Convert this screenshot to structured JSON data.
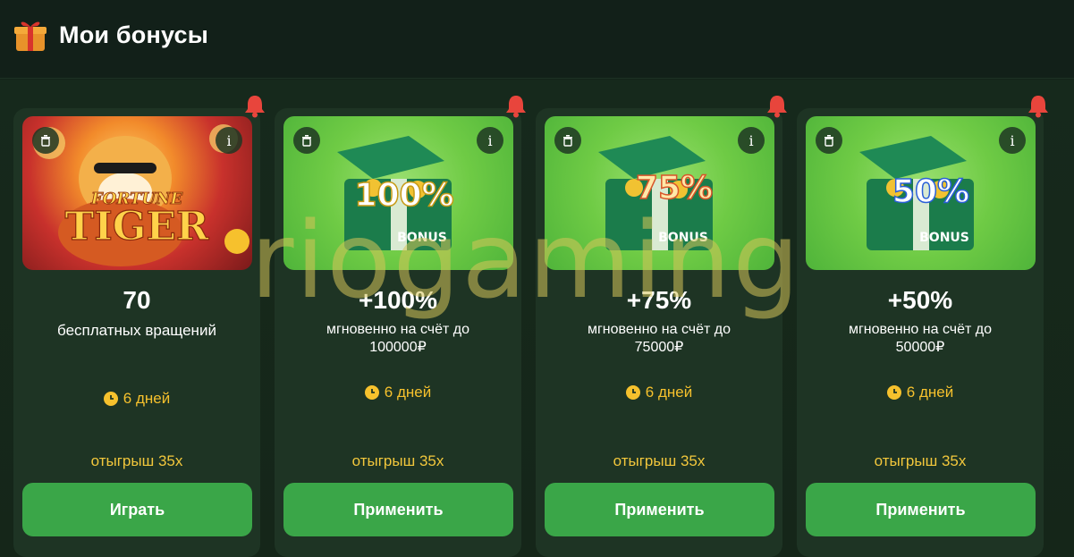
{
  "header": {
    "title": "Мои бонусы",
    "icon": "gift-icon"
  },
  "colors": {
    "accent_green": "#3aa648",
    "timer_yellow": "#f6c12d",
    "bell_red": "#e8453c"
  },
  "cards": [
    {
      "image": "fortune-tiger",
      "image_text": "FORTUNE TIGER",
      "value": "70",
      "description": "бесплатных вращений",
      "timer": "6 дней",
      "wager": "отыгрыш 35x",
      "button": "Играть"
    },
    {
      "image": "bonus-chest",
      "image_text": "100%",
      "image_label": "BONUS",
      "value": "+100%",
      "description": "мгновенно на счёт до 100000₽",
      "timer": "6 дней",
      "wager": "отыгрыш 35x",
      "button": "Применить"
    },
    {
      "image": "bonus-chest",
      "image_text": "75%",
      "image_label": "BONUS",
      "value": "+75%",
      "description": "мгновенно на счёт до 75000₽",
      "timer": "6 дней",
      "wager": "отыгрыш 35x",
      "button": "Применить"
    },
    {
      "image": "bonus-chest",
      "image_text": "50%",
      "image_label": "BONUS",
      "value": "+50%",
      "description": "мгновенно на счёт до 50000₽",
      "timer": "6 дней",
      "wager": "отыгрыш 35x",
      "button": "Применить"
    }
  ],
  "watermark": "riogaming"
}
